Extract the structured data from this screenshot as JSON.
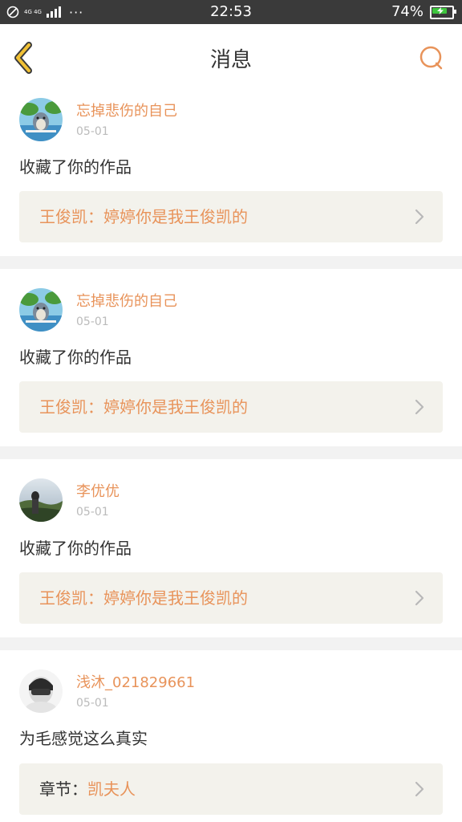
{
  "status_bar": {
    "network": "4G 4G",
    "time": "22:53",
    "battery": "74%",
    "battery_color": "#3ec63e"
  },
  "header": {
    "title": "消息",
    "back_icon": "chevron-left-icon",
    "search_icon": "search-icon",
    "accent_color": "#e8935a"
  },
  "messages": [
    {
      "username": "忘掉悲伤的自己",
      "date": "05-01",
      "action": "收藏了你的作品",
      "quote_prefix": "",
      "quote_text": "王俊凯：婷婷你是我王俊凯的"
    },
    {
      "username": "忘掉悲伤的自己",
      "date": "05-01",
      "action": "收藏了你的作品",
      "quote_prefix": "",
      "quote_text": "王俊凯：婷婷你是我王俊凯的"
    },
    {
      "username": "李优优",
      "date": "05-01",
      "action": "收藏了你的作品",
      "quote_prefix": "",
      "quote_text": "王俊凯：婷婷你是我王俊凯的"
    },
    {
      "username": "浅沐_021829661",
      "date": "05-01",
      "action": "为毛感觉这么真实",
      "quote_prefix": "章节：",
      "quote_text": "凯夫人"
    }
  ]
}
